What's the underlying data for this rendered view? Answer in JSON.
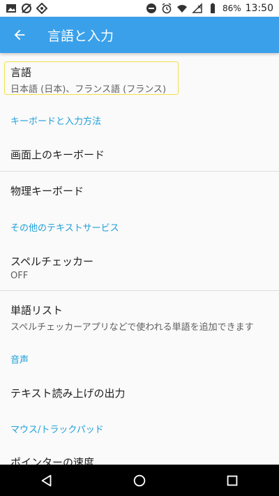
{
  "status_bar": {
    "battery_percent": "86%",
    "time": "13:50",
    "icons_left": [
      "image-icon",
      "sync-off-icon",
      "data-saver-icon"
    ],
    "icons_right": [
      "dnd-icon",
      "alarm-icon",
      "wifi-icon",
      "signal-icon",
      "battery-icon"
    ]
  },
  "app_bar": {
    "title": "言語と入力",
    "background": "#3aa0ea"
  },
  "language": {
    "title": "言語",
    "summary": "日本語 (日本)、フランス語 (フランス)"
  },
  "keyboard_section": {
    "header": "キーボードと入力方法",
    "items": [
      {
        "title": "画面上のキーボード"
      },
      {
        "title": "物理キーボード"
      }
    ]
  },
  "other_text_services": {
    "header": "その他のテキストサービス",
    "spell_checker": {
      "title": "スペルチェッカー",
      "summary": "OFF"
    },
    "word_list": {
      "title": "単語リスト",
      "summary": "スペルチェッカーアプリなどで使われる単語を追加できます"
    }
  },
  "voice_section": {
    "header": "音声",
    "tts": {
      "title": "テキスト読み上げの出力"
    }
  },
  "mouse_section": {
    "header": "マウス/トラックパッド",
    "pointer_speed": {
      "title": "ポインターの速度"
    }
  },
  "colors": {
    "accent": "#1e9fd8",
    "highlight_border": "#f0e24a"
  }
}
